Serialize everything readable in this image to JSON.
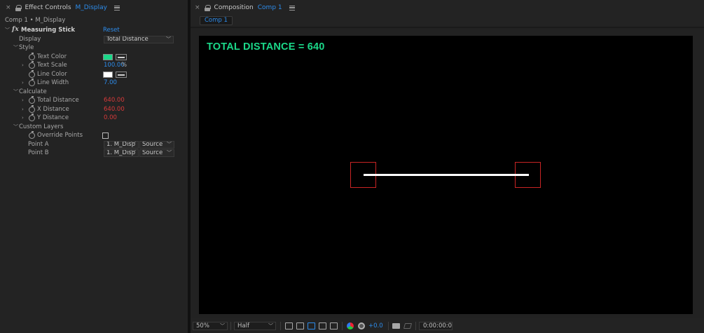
{
  "left_panel": {
    "tab_close": "×",
    "tab_title": "Effect Controls",
    "tab_layer": "M_Display",
    "breadcrumb": "Comp 1 • M_Display",
    "effect": {
      "fx_glyph": "fx",
      "name": "Measuring Stick",
      "reset_label": "Reset",
      "display_label": "Display",
      "display_value": "Total Distance",
      "style_group": "Style",
      "text_color_label": "Text Color",
      "text_color": "#1bd889",
      "text_scale_label": "Text Scale",
      "text_scale_value": "100.00",
      "text_scale_unit": "%",
      "line_color_label": "Line Color",
      "line_color": "#ffffff",
      "line_width_label": "Line Width",
      "line_width_value": "7.00",
      "calculate_group": "Calculate",
      "total_distance_label": "Total Distance",
      "total_distance_value": "640.00",
      "x_distance_label": "X Distance",
      "x_distance_value": "640.00",
      "y_distance_label": "Y Distance",
      "y_distance_value": "0.00",
      "custom_layers_group": "Custom Layers",
      "override_points_label": "Override Points",
      "override_points_checked": false,
      "point_a_label": "Point A",
      "point_a_layer": "1. M_Disp",
      "point_a_source": "Source",
      "point_b_label": "Point B",
      "point_b_layer": "1. M_Disp",
      "point_b_source": "Source"
    }
  },
  "right_panel": {
    "tab_close": "×",
    "tab_title": "Composition",
    "tab_comp": "Comp 1",
    "comp_tab_label": "Comp 1",
    "canvas_text": "TOTAL DISTANCE = 640",
    "toolbar": {
      "zoom": "50%",
      "resolution": "Half",
      "exposure": "+0.0",
      "timecode": "0:00:00:00"
    }
  },
  "colors": {
    "accent_blue": "#2d8ceb",
    "value_red": "#d83a3a",
    "text_green": "#1bd889",
    "point_box_red": "#c82424"
  }
}
